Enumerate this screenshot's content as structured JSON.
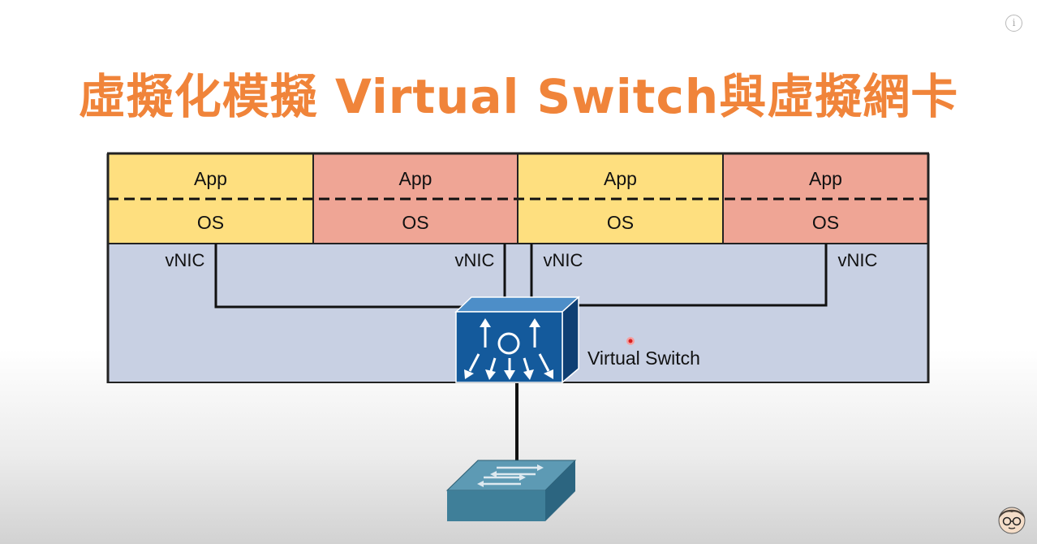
{
  "title": "虛擬化模擬 Virtual Switch與虛擬網卡",
  "info_icon": "info-icon",
  "vms": [
    {
      "app": "App",
      "os": "OS",
      "color": "#fedf7f"
    },
    {
      "app": "App",
      "os": "OS",
      "color": "#efa595"
    },
    {
      "app": "App",
      "os": "OS",
      "color": "#fedf7f"
    },
    {
      "app": "App",
      "os": "OS",
      "color": "#efa595"
    }
  ],
  "vnics": [
    "vNIC",
    "vNIC",
    "vNIC",
    "vNIC"
  ],
  "virtual_switch_label": "Virtual Switch",
  "colors": {
    "title": "#f0843a",
    "host_panel": "#c8d0e3",
    "switch_blue": "#145a9c",
    "physical_switch": "#3f7f99"
  },
  "icons": [
    "virtual-switch-icon",
    "physical-switch-icon",
    "laser-pointer-dot",
    "avatar-icon"
  ]
}
